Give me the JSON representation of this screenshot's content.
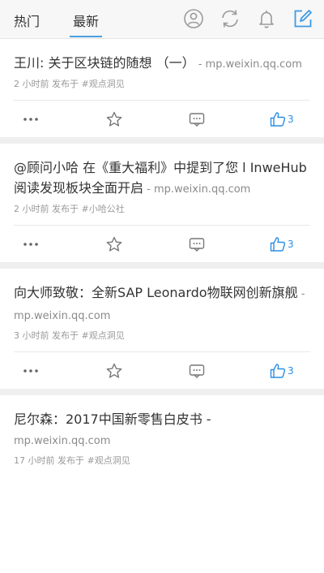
{
  "tabs": {
    "hot": "热门",
    "latest": "最新"
  },
  "icons": [
    "user-icon",
    "refresh-icon",
    "bell-icon",
    "compose-icon"
  ],
  "accent": "#2b8ee3",
  "posts": [
    {
      "title": "王川: 关于区块链的随想 （一）",
      "domain": " - mp.weixin.qq.com",
      "meta": "2 小时前 发布于 #观点洞见",
      "likes": "3"
    },
    {
      "title": "@顾问小哈 在《重大福利》中提到了您 l InweHub阅读发现板块全面开启",
      "domain": " - mp.weixin.qq.com",
      "meta": "2 小时前 发布于 #小哈公社",
      "likes": "3"
    },
    {
      "title": "向大师致敬：全新SAP Leonardo物联网创新旗舰",
      "domain": " - mp.weixin.qq.com",
      "meta": "3 小时前 发布于 #观点洞见",
      "likes": "3"
    },
    {
      "title": "尼尔森：2017中国新零售白皮书 -",
      "domain": "mp.weixin.qq.com",
      "meta": "17 小时前 发布于 #观点洞见",
      "likes": ""
    }
  ]
}
